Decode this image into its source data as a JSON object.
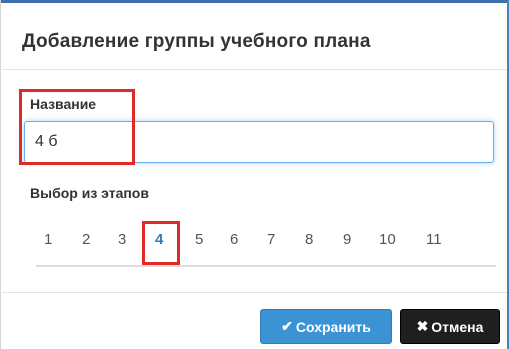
{
  "dialog": {
    "title": "Добавление группы учебного плана"
  },
  "form": {
    "name_label": "Название",
    "name_value": "4 б",
    "stages_label": "Выбор из этапов",
    "stages": [
      "1",
      "2",
      "3",
      "4",
      "5",
      "6",
      "7",
      "8",
      "9",
      "10",
      "11"
    ],
    "selected_stage": "4"
  },
  "footer": {
    "save_label": "Сохранить",
    "save_icon": "checkmark-icon",
    "cancel_label": "Отмена",
    "cancel_icon": "x-icon"
  },
  "colors": {
    "highlight": "#e02a2a",
    "accent": "#337ab7",
    "save_button": "#3c93d4",
    "cancel_button": "#1f1f1f"
  }
}
